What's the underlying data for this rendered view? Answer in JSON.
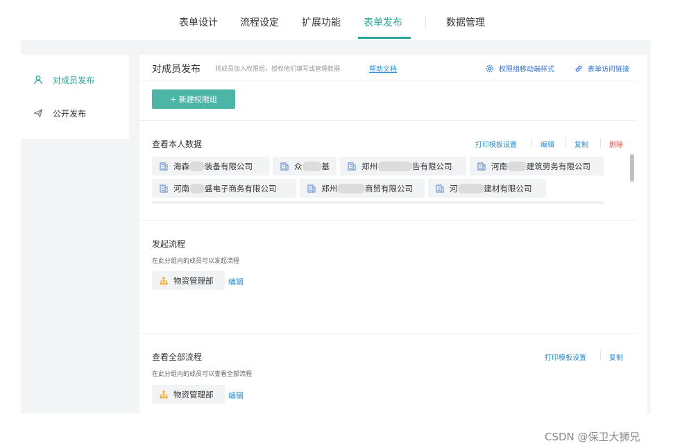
{
  "top_tabs": [
    {
      "label": "表单设计"
    },
    {
      "label": "流程设定"
    },
    {
      "label": "扩展功能"
    },
    {
      "label": "表单发布",
      "active": true
    },
    {
      "label": "数据管理"
    }
  ],
  "sidebar": {
    "items": [
      {
        "label": "对成员发布",
        "icon": "user-icon",
        "active": true
      },
      {
        "label": "公开发布",
        "icon": "send-icon"
      }
    ]
  },
  "panel": {
    "title": "对成员发布",
    "description": "将成员加入权限组，授权他们填写或管理数据",
    "help_link": "帮助文档",
    "link_mobile_style": "权限组移动端样式",
    "link_form_url": "表单访问链接",
    "new_group_button": "+ 新建权限组"
  },
  "section_own_data": {
    "title": "查看本人数据",
    "actions": {
      "print": "打印模板设置",
      "edit": "编辑",
      "copy": "复制",
      "delete": "删除"
    },
    "members_row1": [
      {
        "pre": "海森",
        "post": "装备有限公司"
      },
      {
        "pre": "众",
        "post": "基"
      },
      {
        "pre": "郑州",
        "post": "告有限公司"
      },
      {
        "pre": "河南",
        "post": "建筑劳务有限公司"
      }
    ],
    "members_row2": [
      {
        "pre": "河南",
        "post": "盛电子商务有限公司"
      },
      {
        "pre": "郑州",
        "post": "商贸有限公司"
      },
      {
        "pre": "河",
        "post": "建材有限公司"
      }
    ]
  },
  "section_start_flow": {
    "title": "发起流程",
    "description": "在此分组内的成员可以发起流程",
    "dept": "物资管理部",
    "edit": "编辑"
  },
  "section_all_flow": {
    "title": "查看全部流程",
    "description": "在此分组内的成员可以查看全部流程",
    "actions": {
      "print": "打印模板设置",
      "copy": "复制"
    },
    "dept": "物资管理部",
    "edit": "编辑"
  },
  "watermark": "CSDN @保卫大狮兄",
  "colors": {
    "accent": "#26a69a",
    "button": "#4cb5a8",
    "link": "#2a8fd8",
    "danger": "#e0514e",
    "dept_icon": "#f5a623"
  }
}
